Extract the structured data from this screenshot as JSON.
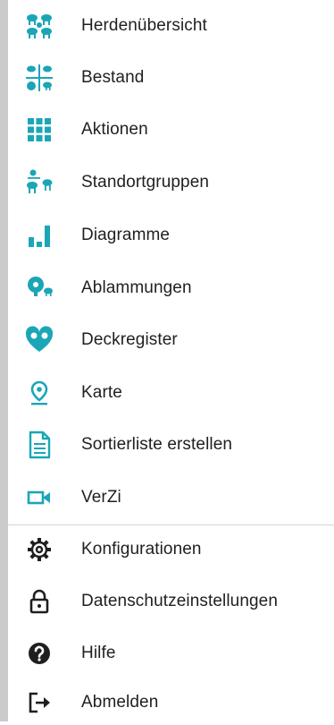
{
  "colors": {
    "teal": "#1aa6b7",
    "dark": "#1f1f1f",
    "divider": "#d4d4d4"
  },
  "menu": {
    "items": [
      {
        "label": "Herdenübersicht",
        "icon": "herd-overview-icon"
      },
      {
        "label": "Bestand",
        "icon": "stock-icon"
      },
      {
        "label": "Aktionen",
        "icon": "actions-grid-icon"
      },
      {
        "label": "Standortgruppen",
        "icon": "location-groups-icon"
      },
      {
        "label": "Diagramme",
        "icon": "bar-chart-icon"
      },
      {
        "label": "Ablammungen",
        "icon": "lambing-icon"
      },
      {
        "label": "Deckregister",
        "icon": "mating-register-icon"
      },
      {
        "label": "Karte",
        "icon": "map-pin-icon"
      },
      {
        "label": "Sortierliste erstellen",
        "icon": "document-list-icon"
      },
      {
        "label": "VerZi",
        "icon": "video-camera-icon"
      }
    ],
    "secondary": [
      {
        "label": "Konfigurationen",
        "icon": "gear-icon"
      },
      {
        "label": "Datenschutzeinstellungen",
        "icon": "lock-icon"
      },
      {
        "label": "Hilfe",
        "icon": "help-icon"
      },
      {
        "label": "Abmelden",
        "icon": "logout-icon"
      }
    ]
  }
}
